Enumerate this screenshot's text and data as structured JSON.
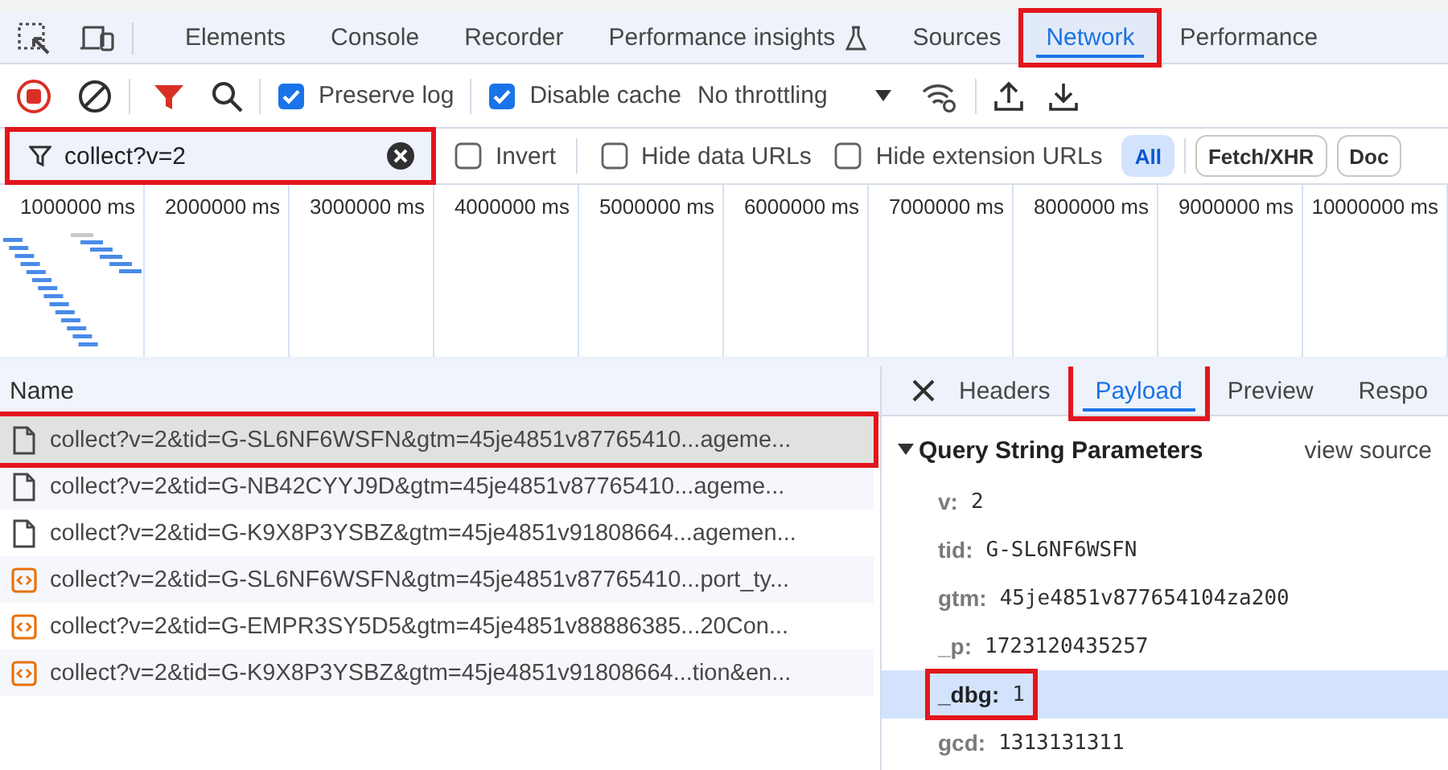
{
  "main_tabs": [
    {
      "label": "Elements",
      "selected": false,
      "experimental": false,
      "highlighted": false
    },
    {
      "label": "Console",
      "selected": false,
      "experimental": false,
      "highlighted": false
    },
    {
      "label": "Recorder",
      "selected": false,
      "experimental": false,
      "highlighted": false
    },
    {
      "label": "Performance insights",
      "selected": false,
      "experimental": true,
      "highlighted": false
    },
    {
      "label": "Sources",
      "selected": false,
      "experimental": false,
      "highlighted": false
    },
    {
      "label": "Network",
      "selected": true,
      "experimental": false,
      "highlighted": true
    },
    {
      "label": "Performance",
      "selected": false,
      "experimental": false,
      "highlighted": false
    }
  ],
  "toolbar": {
    "recording": true,
    "options": [
      {
        "label": "Preserve log",
        "checked": true
      },
      {
        "label": "Disable cache",
        "checked": true
      }
    ],
    "throttling": "No throttling"
  },
  "filter": {
    "value": "collect?v=2",
    "highlighted": true,
    "options": [
      {
        "label": "Invert",
        "checked": false
      },
      {
        "label": "Hide data URLs",
        "checked": false
      },
      {
        "label": "Hide extension URLs",
        "checked": false
      }
    ],
    "type_buttons": [
      {
        "label": "All",
        "selected": true
      },
      {
        "label": "Fetch/XHR",
        "selected": false
      },
      {
        "label": "Doc",
        "selected": false
      }
    ]
  },
  "timeline": {
    "ticks": [
      "1000000 ms",
      "2000000 ms",
      "3000000 ms",
      "4000000 ms",
      "5000000 ms",
      "6000000 ms",
      "7000000 ms",
      "8000000 ms",
      "9000000 ms",
      "10000000 ms"
    ]
  },
  "requests": {
    "column": "Name",
    "rows": [
      {
        "name": "collect?v=2&tid=G-SL6NF6WSFN&gtm=45je4851v87765410...ageme...",
        "kind": "document",
        "selected": true,
        "highlighted": true
      },
      {
        "name": "collect?v=2&tid=G-NB42CYYJ9D&gtm=45je4851v87765410...ageme...",
        "kind": "document",
        "selected": false,
        "highlighted": false
      },
      {
        "name": "collect?v=2&tid=G-K9X8P3YSBZ&gtm=45je4851v91808664...agemen...",
        "kind": "document",
        "selected": false,
        "highlighted": false
      },
      {
        "name": "collect?v=2&tid=G-SL6NF6WSFN&gtm=45je4851v87765410...port_ty...",
        "kind": "script",
        "selected": false,
        "highlighted": false
      },
      {
        "name": "collect?v=2&tid=G-EMPR3SY5D5&gtm=45je4851v88886385...20Con...",
        "kind": "script",
        "selected": false,
        "highlighted": false
      },
      {
        "name": "collect?v=2&tid=G-K9X8P3YSBZ&gtm=45je4851v91808664...tion&en...",
        "kind": "script",
        "selected": false,
        "highlighted": false
      }
    ]
  },
  "details": {
    "tabs": [
      {
        "label": "Headers",
        "selected": false,
        "highlighted": false
      },
      {
        "label": "Payload",
        "selected": true,
        "highlighted": true
      },
      {
        "label": "Preview",
        "selected": false,
        "highlighted": false
      },
      {
        "label": "Respo",
        "selected": false,
        "highlighted": false
      }
    ],
    "section": {
      "title": "Query String Parameters",
      "expanded": true,
      "link": "view source"
    },
    "params": [
      {
        "key": "v:",
        "value": "2",
        "selected": false,
        "highlighted": false
      },
      {
        "key": "tid:",
        "value": "G-SL6NF6WSFN",
        "selected": false,
        "highlighted": false
      },
      {
        "key": "gtm:",
        "value": "45je4851v877654104za200",
        "selected": false,
        "highlighted": false
      },
      {
        "key": "_p:",
        "value": "1723120435257",
        "selected": false,
        "highlighted": false
      },
      {
        "key": "_dbg:",
        "value": "1",
        "selected": true,
        "highlighted": true
      },
      {
        "key": "gcd:",
        "value": "1313131311",
        "selected": false,
        "highlighted": false
      }
    ]
  }
}
